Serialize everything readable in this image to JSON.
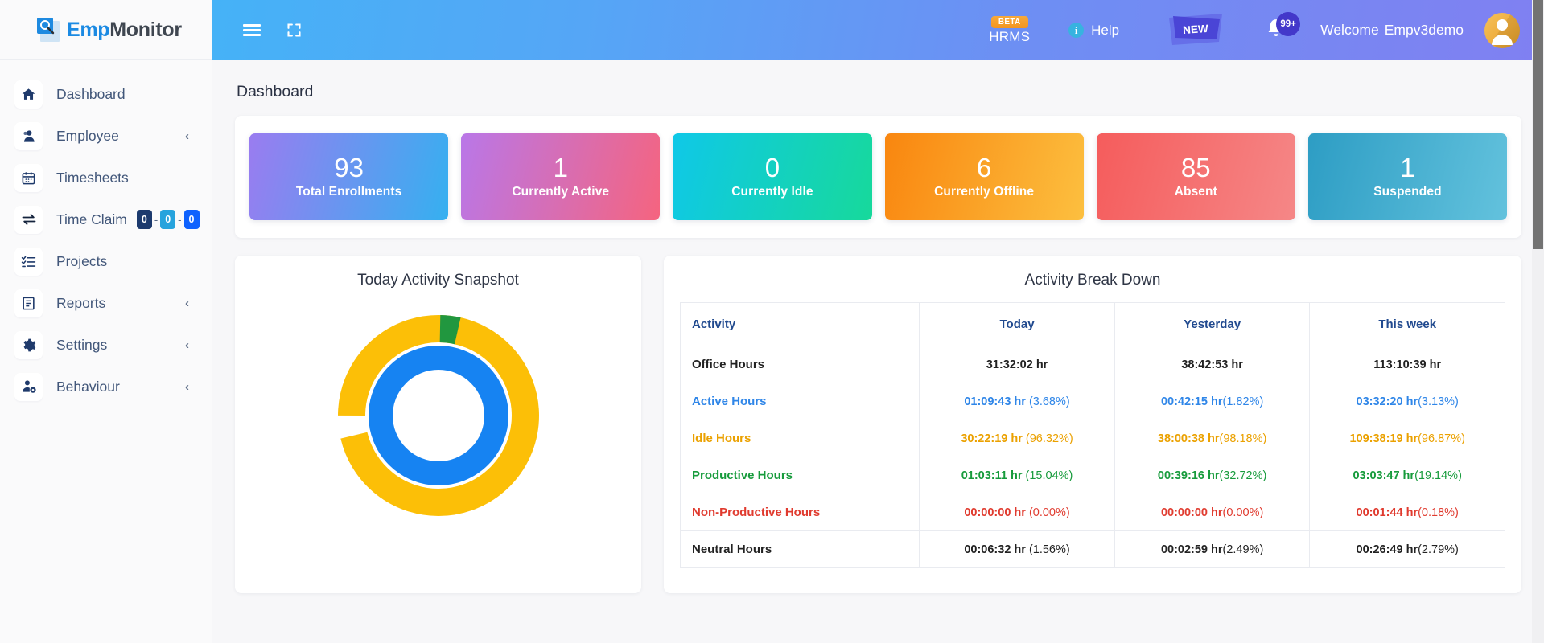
{
  "brand": {
    "emp": "Emp",
    "monitor": "Monitor",
    "logo_icon": "magnifier-document-icon"
  },
  "sidebar": {
    "items": [
      {
        "label": "Dashboard",
        "icon": "home-icon",
        "expandable": false,
        "chevron": "‹"
      },
      {
        "label": "Employee",
        "icon": "user-icon",
        "expandable": true,
        "chevron": "‹"
      },
      {
        "label": "Timesheets",
        "icon": "calendar-icon",
        "expandable": false,
        "chevron": "‹"
      },
      {
        "label": "Time Claim",
        "icon": "exchange-icon",
        "expandable": false,
        "chevron": "‹",
        "badges": [
          {
            "value": "0",
            "color": "#1c3a6e"
          },
          {
            "value": "0",
            "color": "#27a3dd"
          },
          {
            "value": "0",
            "color": "#0f62fe"
          }
        ],
        "separator": "-"
      },
      {
        "label": "Projects",
        "icon": "checklist-icon",
        "expandable": false,
        "chevron": "‹"
      },
      {
        "label": "Reports",
        "icon": "document-icon",
        "expandable": true,
        "chevron": "‹"
      },
      {
        "label": "Settings",
        "icon": "gear-icon",
        "expandable": true,
        "chevron": "‹"
      },
      {
        "label": "Behaviour",
        "icon": "user-gear-icon",
        "expandable": true,
        "chevron": "‹"
      }
    ]
  },
  "topbar": {
    "menu_icon": "hamburger-icon",
    "fullscreen_icon": "fullscreen-icon",
    "hrms_label": "HRMS",
    "beta_label": "BETA",
    "help_label": "Help",
    "help_icon": "info-icon",
    "new_banner_label": "NEW",
    "bell_icon": "bell-icon",
    "notification_count": "99+",
    "welcome_label": "Welcome",
    "user_name": "Empv3demo",
    "avatar_icon": "user-avatar"
  },
  "page": {
    "title": "Dashboard"
  },
  "stats": [
    {
      "value": "93",
      "label": "Total Enrollments",
      "from": "#9a7cf0",
      "to": "#35b0f0"
    },
    {
      "value": "1",
      "label": "Currently Active",
      "from": "#b977e8",
      "to": "#f5647f"
    },
    {
      "value": "0",
      "label": "Currently Idle",
      "from": "#0fc8e8",
      "to": "#17d99b"
    },
    {
      "value": "6",
      "label": "Currently Offline",
      "from": "#f9860f",
      "to": "#fcbf3f"
    },
    {
      "value": "85",
      "label": "Absent",
      "from": "#f55c5c",
      "to": "#f58787"
    },
    {
      "value": "1",
      "label": "Suspended",
      "from": "#2d9dc4",
      "to": "#63c2dd"
    }
  ],
  "snapshot": {
    "title": "Today Activity Snapshot"
  },
  "breakdown": {
    "title": "Activity Break Down",
    "headers": [
      "Activity",
      "Today",
      "Yesterday",
      "This week"
    ],
    "rows": [
      {
        "activity": "Office Hours",
        "color": "#222222",
        "today_time": "31:32:02 hr",
        "today_pct": "",
        "yest_time": "38:42:53 hr",
        "yest_pct": "",
        "week_time": "113:10:39 hr",
        "week_pct": ""
      },
      {
        "activity": "Active Hours",
        "color": "#2f86e8",
        "today_time": "01:09:43 hr",
        "today_pct": " (3.68%)",
        "yest_time": "00:42:15 hr",
        "yest_pct": "(1.82%)",
        "week_time": "03:32:20 hr",
        "week_pct": "(3.13%)"
      },
      {
        "activity": "Idle Hours",
        "color": "#eba100",
        "today_time": "30:22:19 hr",
        "today_pct": " (96.32%)",
        "yest_time": "38:00:38 hr",
        "yest_pct": "(98.18%)",
        "week_time": "109:38:19 hr",
        "week_pct": "(96.87%)"
      },
      {
        "activity": "Productive Hours",
        "color": "#179b3c",
        "today_time": "01:03:11 hr",
        "today_pct": " (15.04%)",
        "yest_time": "00:39:16 hr",
        "yest_pct": "(32.72%)",
        "week_time": "03:03:47 hr",
        "week_pct": "(19.14%)"
      },
      {
        "activity": "Non-Productive Hours",
        "color": "#e03b2f",
        "today_time": "00:00:00 hr",
        "today_pct": " (0.00%)",
        "yest_time": "00:00:00 hr",
        "yest_pct": "(0.00%)",
        "week_time": "00:01:44 hr",
        "week_pct": "(0.18%)"
      },
      {
        "activity": "Neutral Hours",
        "color": "#222222",
        "today_time": "00:06:32 hr",
        "today_pct": " (1.56%)",
        "yest_time": "00:02:59 hr",
        "yest_pct": "(2.49%)",
        "week_time": "00:26:49 hr",
        "week_pct": "(2.79%)"
      }
    ]
  },
  "chart_data": {
    "type": "pie",
    "title": "Today Activity Snapshot",
    "variant": "nested-donut",
    "legend": "none",
    "rings": [
      {
        "name": "outer",
        "labels": [
          "Idle Hours",
          "Productive Hours"
        ],
        "values": [
          96.32,
          3.68
        ],
        "colors": [
          "#fcbf07",
          "#21973f"
        ]
      },
      {
        "name": "inner",
        "labels": [
          "Office Hours"
        ],
        "values": [
          100
        ],
        "colors": [
          "#1683f2"
        ]
      }
    ]
  },
  "scrollbar": {
    "thumb_color": "#737373"
  }
}
